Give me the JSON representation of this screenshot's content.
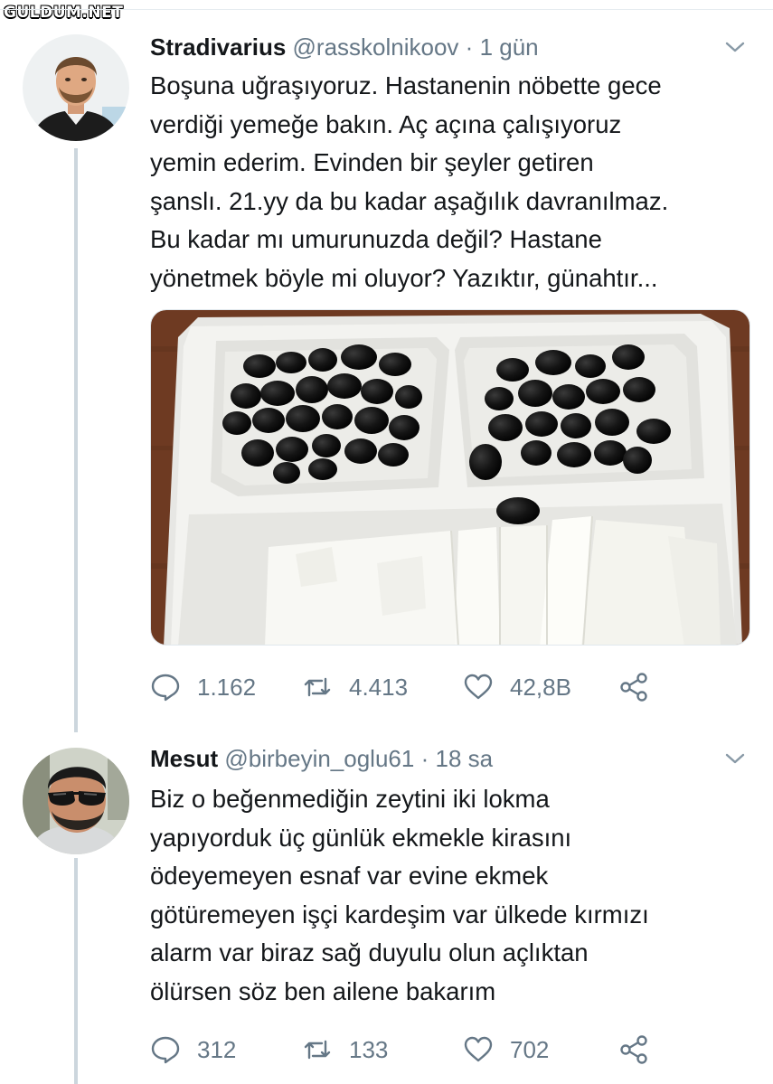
{
  "watermark": "GULDUM.NET",
  "tweets": [
    {
      "name": "Stradivarius",
      "handle": "@rasskolnikoov",
      "separator": "·",
      "time": "1 gün",
      "text_lines": [
        "Boşuna uğraşıyoruz. Hastanenin nöbette gece",
        "verdiği yemeğe bakın. Aç açına çalışıyoruz",
        "yemin ederim. Evinden bir şeyler getiren",
        "şanslı. 21.yy da bu kadar aşağılık davranılmaz.",
        "Bu kadar mı umurunuzda değil? Hastane",
        "yönetmek böyle mi oluyor? Yazıktır, günahtır..."
      ],
      "replies": "1.162",
      "retweets": "4.413",
      "likes": "42,8B"
    },
    {
      "name": "Mesut",
      "handle": "@birbeyin_oglu61",
      "separator": "·",
      "time": "18 sa",
      "text_lines": [
        "Biz o beğenmediğin zeytini iki lokma",
        "yapıyorduk üç günlük ekmekle kirasını",
        "ödeyemeyen esnaf var evine ekmek",
        "götüremeyen işçi kardeşim var ülkede kırmızı",
        "alarm var biraz sağ duyulu olun açlıktan",
        "ölürsen söz ben ailene bakarım"
      ],
      "replies": "312",
      "retweets": "133",
      "likes": "702"
    }
  ],
  "icons": {
    "reply": "speech-bubble-icon",
    "retweet": "retweet-arrows-icon",
    "like": "heart-icon",
    "share": "share-nodes-icon",
    "caret": "chevron-down-icon"
  },
  "colors": {
    "text": "#14171a",
    "secondary": "#657786",
    "thread_line": "#ccd6dd"
  }
}
